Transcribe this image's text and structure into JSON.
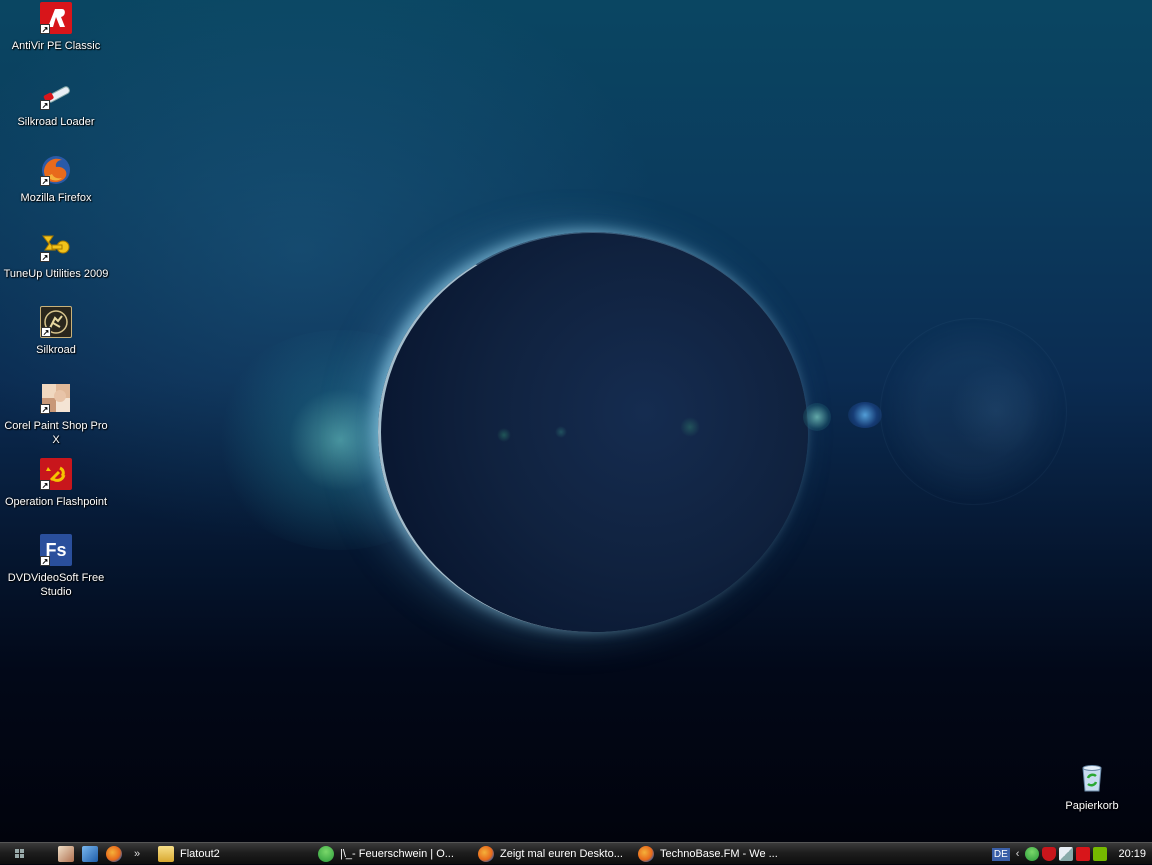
{
  "desktop": {
    "icons": [
      {
        "label": "AntiVir PE Classic",
        "icon": "antivir-umbrella-icon"
      },
      {
        "label": "Silkroad Loader",
        "icon": "syringe-icon"
      },
      {
        "label": "Mozilla Firefox",
        "icon": "firefox-icon"
      },
      {
        "label": "TuneUp Utilities 2009",
        "icon": "tuneup-icon"
      },
      {
        "label": "Silkroad",
        "icon": "silkroad-icon"
      },
      {
        "label": "Corel Paint Shop Pro X",
        "icon": "paint-shop-pro-icon"
      },
      {
        "label": "Operation Flashpoint",
        "icon": "operation-flashpoint-icon"
      },
      {
        "label": "DVDVideoSoft Free Studio",
        "icon": "dvdvideosoft-icon",
        "glyph": "Fs"
      }
    ],
    "recycle_bin": {
      "label": "Papierkorb",
      "icon": "recycle-bin-icon"
    }
  },
  "taskbar": {
    "quick_launch": [
      "show-desktop-icon",
      "ie-icon",
      "firefox-icon"
    ],
    "overflow": "»",
    "tasks": [
      {
        "label": "Flatout2",
        "icon": "folder-icon"
      },
      {
        "label": "|\\_-  Feuerschwein | O...",
        "icon": "messenger-icon"
      },
      {
        "label": "Zeigt mal euren Deskto...",
        "icon": "firefox-icon"
      },
      {
        "label": "TechnoBase.FM - We ...",
        "icon": "firefox-icon"
      }
    ],
    "tray": {
      "language": "DE",
      "expand": "‹",
      "icons": [
        "messenger-icon",
        "shield-icon",
        "syringe-icon",
        "antivir-icon",
        "nvidia-icon"
      ],
      "clock": "20:19"
    }
  },
  "colors": {
    "antivir_red": "#d8151a",
    "firefox_orange": "#e86a1c",
    "fs_blue": "#2a4f9c",
    "taskbar_bg": "#1e1e1e"
  }
}
